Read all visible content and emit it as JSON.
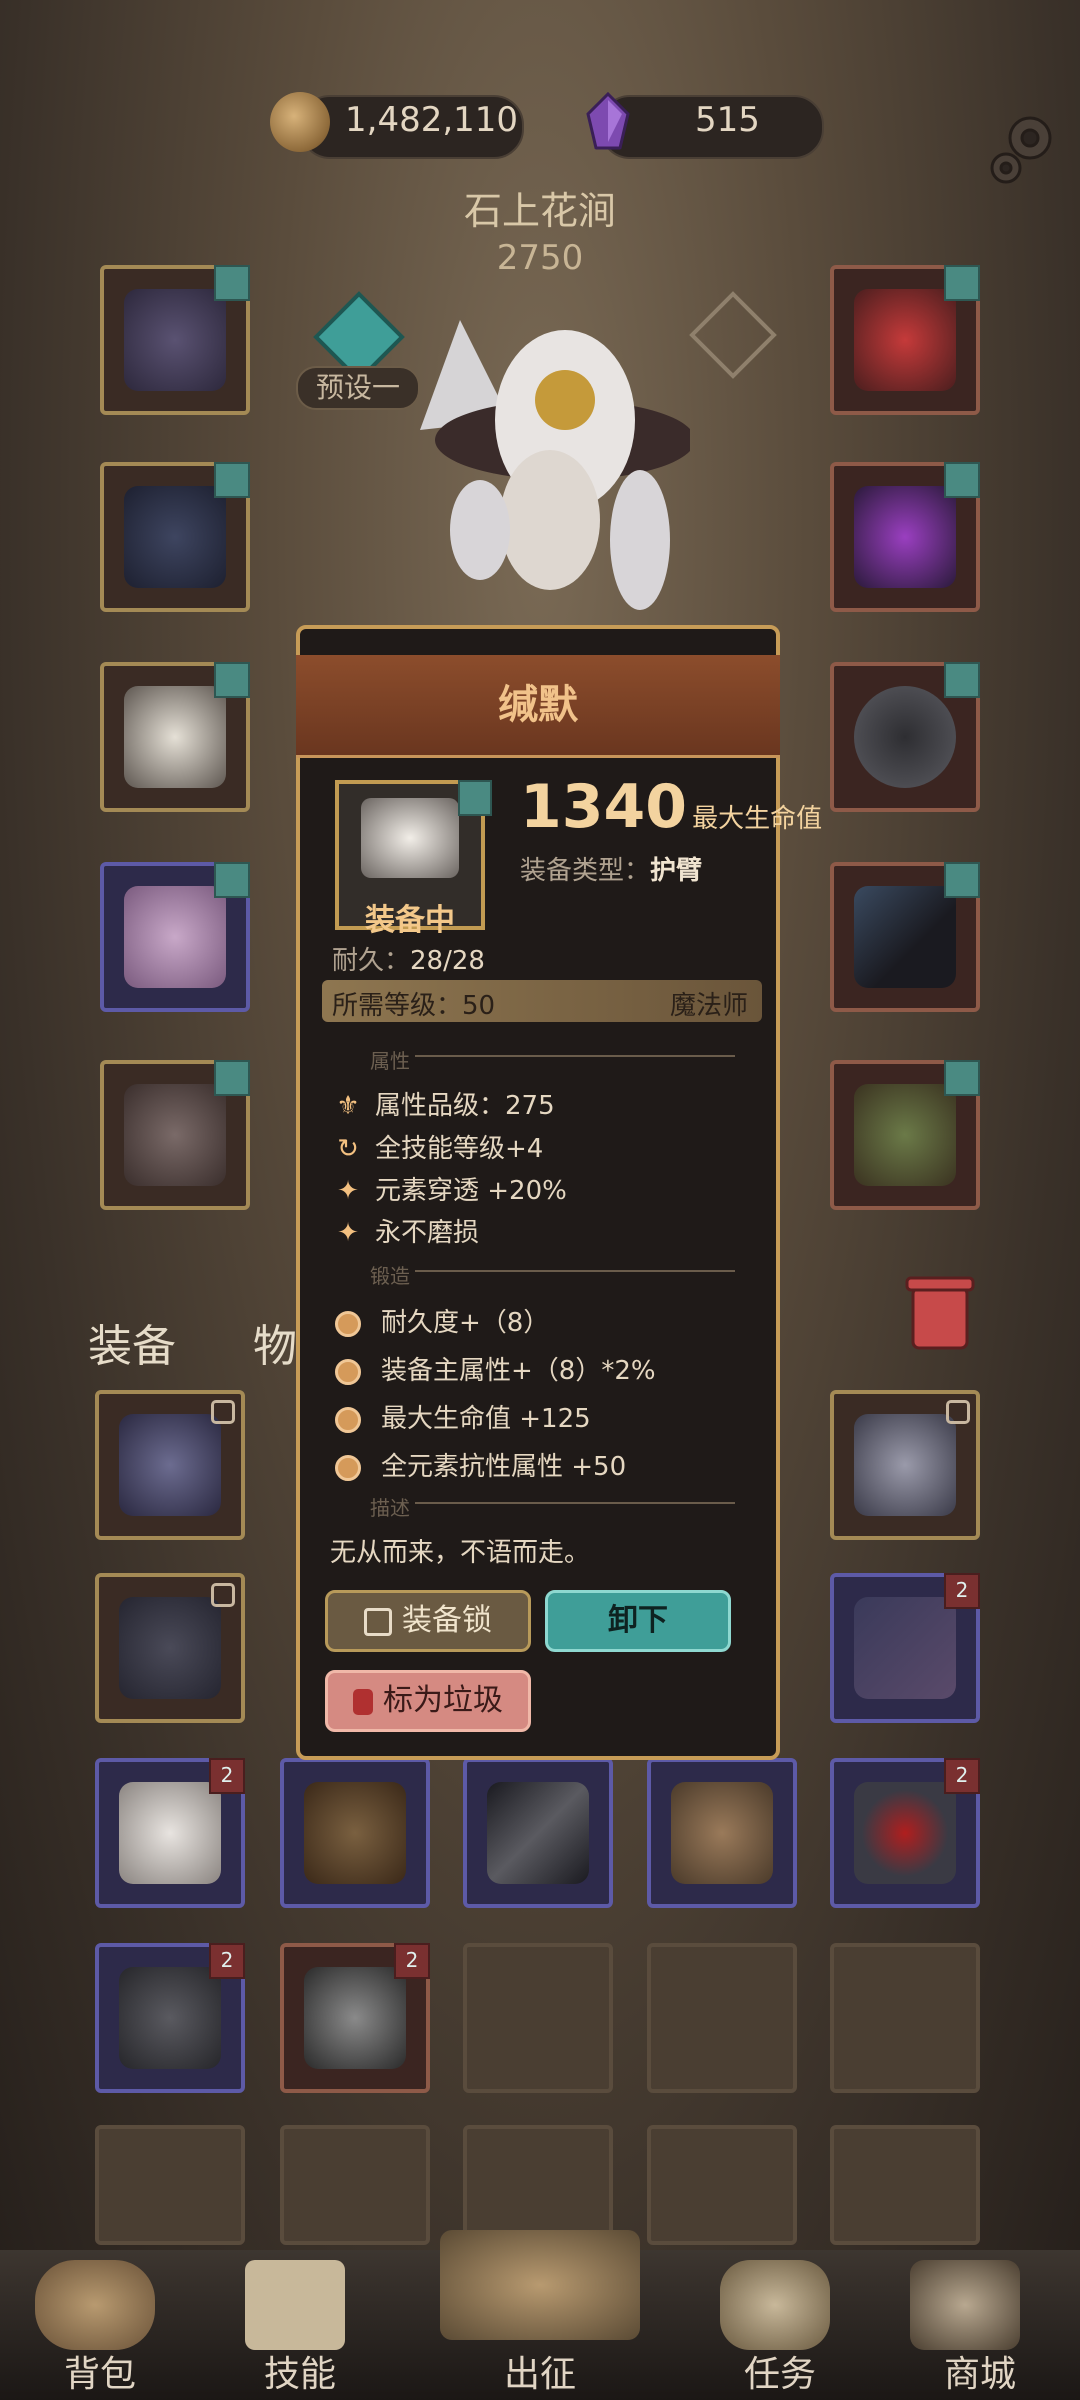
{
  "currency": {
    "gold": "1,482,110",
    "gems": "515"
  },
  "character": {
    "name": "石上花涧",
    "power": "2750",
    "preset_label": "预设一"
  },
  "equipment_popup": {
    "title": "缄默",
    "equipped_label": "装备中",
    "stat_value": "1340",
    "stat_label": "最大生命值",
    "type_label": "装备类型：",
    "type_value": "护臂",
    "durability_label": "耐久：",
    "durability_value": "28/28",
    "required_level": "所需等级：50",
    "class": "魔法师",
    "section_attributes": "属性",
    "attributes": [
      {
        "icon": "quality-icon",
        "text": "属性品级：275"
      },
      {
        "icon": "refresh-icon",
        "text": "全技能等级+4"
      },
      {
        "icon": "sparkle-icon",
        "text": "元素穿透 +20%"
      },
      {
        "icon": "sparkle-icon",
        "text": "永不磨损"
      }
    ],
    "section_forge": "锻造",
    "forge": [
      "耐久度+（8）",
      "装备主属性+（8）*2%",
      "最大生命值 +125",
      "全元素抗性属性 +50"
    ],
    "section_desc": "描述",
    "description": "无从而来，不语而走。",
    "buttons": {
      "lock": "装备锁",
      "unequip": "卸下",
      "junk": "标为垃圾"
    }
  },
  "inventory_tabs": {
    "equip": "装备",
    "items": "物品"
  },
  "nav": {
    "bag": "背包",
    "skills": "技能",
    "battle": "出征",
    "quests": "任务",
    "shop": "商城"
  },
  "colors": {
    "gold_border": "#a48a55",
    "purple_border": "#5d5aa7",
    "red_border": "#8e5a48",
    "accent_teal": "#3f9e98",
    "popup_title": "#f1c28a"
  }
}
